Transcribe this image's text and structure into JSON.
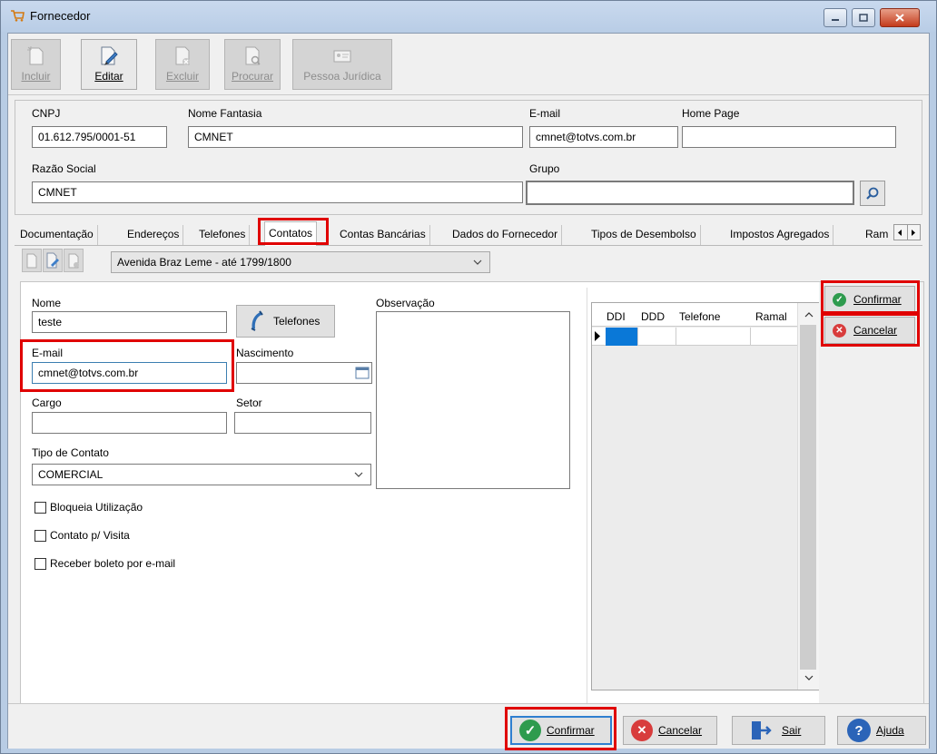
{
  "window": {
    "title": "Fornecedor"
  },
  "toolbar": {
    "incluir": "Incluir",
    "editar": "Editar",
    "excluir": "Excluir",
    "procurar": "Procurar",
    "pessoa_juridica": "Pessoa Jurídica"
  },
  "header": {
    "cnpj_label": "CNPJ",
    "cnpj_value": "01.612.795/0001-51",
    "nome_fantasia_label": "Nome Fantasia",
    "nome_fantasia_value": "CMNET",
    "email_label": "E-mail",
    "email_value": "cmnet@totvs.com.br",
    "home_page_label": "Home Page",
    "home_page_value": "",
    "razao_social_label": "Razão Social",
    "razao_social_value": "CMNET",
    "grupo_label": "Grupo",
    "grupo_value": ""
  },
  "tabs": [
    "Documentação",
    "Endereços",
    "Telefones",
    "Contatos",
    "Contas Bancárias",
    "Dados do Fornecedor",
    "Tipos de Desembolso",
    "Impostos Agregados",
    "Ram"
  ],
  "active_tab": "Contatos",
  "contact": {
    "selected_address": "Avenida Braz Leme - até 1799/1800",
    "nome_label": "Nome",
    "nome_value": "teste",
    "telefones_button": "Telefones",
    "email_label": "E-mail",
    "email_value": "cmnet@totvs.com.br",
    "nascimento_label": "Nascimento",
    "nascimento_value": "",
    "cargo_label": "Cargo",
    "cargo_value": "",
    "setor_label": "Setor",
    "setor_value": "",
    "tipo_contato_label": "Tipo de Contato",
    "tipo_contato_value": "COMERCIAL",
    "observacao_label": "Observação",
    "checkboxes": [
      {
        "label": "Bloqueia Utilização",
        "checked": false
      },
      {
        "label": "Contato p/ Visita",
        "checked": false
      },
      {
        "label": "Receber boleto por e-mail",
        "checked": false
      }
    ]
  },
  "phone_grid": {
    "columns": [
      "DDI",
      "DDD",
      "Telefone",
      "Ramal"
    ]
  },
  "side_buttons": {
    "confirmar": "Confirmar",
    "cancelar": "Cancelar"
  },
  "bottom_buttons": {
    "confirmar": "Confirmar",
    "cancelar": "Cancelar",
    "sair": "Sair",
    "ajuda": "Ajuda"
  },
  "colors": {
    "highlight": "#e00000",
    "confirm_green": "#2e9b4e",
    "cancel_red": "#d83c3c",
    "help_blue": "#2b64b8"
  }
}
